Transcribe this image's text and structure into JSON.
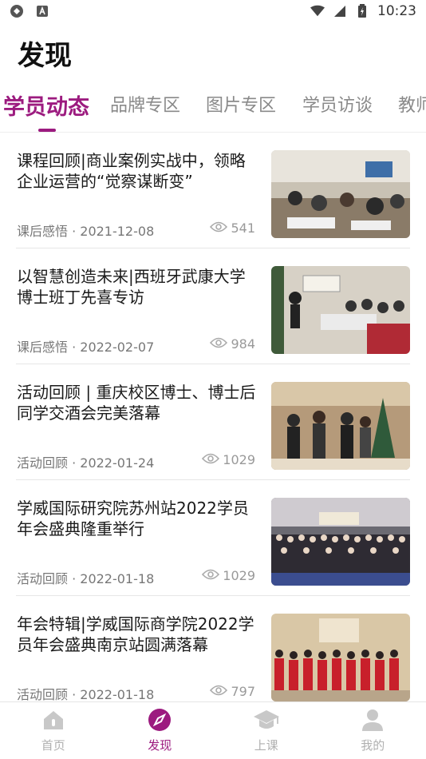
{
  "status_bar": {
    "time": "10:23"
  },
  "header": {
    "title": "发现"
  },
  "tabs": [
    {
      "label": "学员动态",
      "active": true
    },
    {
      "label": "品牌专区",
      "active": false
    },
    {
      "label": "图片专区",
      "active": false
    },
    {
      "label": "学员访谈",
      "active": false
    },
    {
      "label": "教师",
      "active": false
    }
  ],
  "articles": [
    {
      "title": "课程回顾|商业案例实战中，领略企业运营的“觉察谋断变”",
      "category": "课后感悟",
      "date": "2021-12-08",
      "meta": "课后感悟 · 2021-12-08",
      "views": "541"
    },
    {
      "title": "以智慧创造未来|西班牙武康大学博士班丁先喜专访",
      "category": "课后感悟",
      "date": "2022-02-07",
      "meta": "课后感悟 · 2022-02-07",
      "views": "984"
    },
    {
      "title": "活动回顾 | 重庆校区博士、博士后同学交酒会完美落幕",
      "category": "活动回顾",
      "date": "2022-01-24",
      "meta": "活动回顾 · 2022-01-24",
      "views": "1029"
    },
    {
      "title": "学威国际研究院苏州站2022学员年会盛典隆重举行",
      "category": "活动回顾",
      "date": "2022-01-18",
      "meta": "活动回顾 · 2022-01-18",
      "views": "1029"
    },
    {
      "title": "年会特辑|学威国际商学院2022学员年会盛典南京站圆满落幕",
      "category": "活动回顾",
      "date": "2022-01-18",
      "meta": "活动回顾 · 2022-01-18",
      "views": "797"
    }
  ],
  "bottom_nav": [
    {
      "label": "首页",
      "icon": "home-icon",
      "active": false
    },
    {
      "label": "发现",
      "icon": "compass-icon",
      "active": true
    },
    {
      "label": "上课",
      "icon": "graduation-cap-icon",
      "active": false
    },
    {
      "label": "我的",
      "icon": "user-icon",
      "active": false
    }
  ],
  "colors": {
    "accent": "#9c1b7f",
    "inactive": "#b0b0b0"
  }
}
